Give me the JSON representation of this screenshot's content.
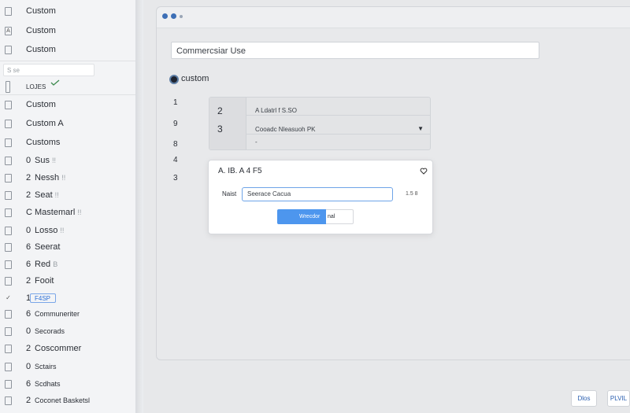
{
  "sidebar": {
    "items": [
      {
        "label": "Custom"
      },
      {
        "label": "Custom"
      },
      {
        "label": "Custom"
      },
      {
        "search_placeholder": "S  se"
      },
      {
        "label": "LOJES"
      },
      {
        "label": "Custom"
      },
      {
        "label": "Custom A"
      },
      {
        "label": "Customs"
      },
      {
        "num": "0",
        "label": "Sus",
        "suffix": "!!"
      },
      {
        "num": "2",
        "label": "Nessh",
        "suffix": "!!"
      },
      {
        "num": "2",
        "label": "Seat",
        "suffix": "!!"
      },
      {
        "num": "C",
        "label": "Mastemarl",
        "suffix": "!!"
      },
      {
        "num": "0",
        "label": "Losso",
        "suffix": "!!"
      },
      {
        "num": "6",
        "label": "Seerat"
      },
      {
        "num": "6",
        "label": "Red",
        "suffix": "B"
      },
      {
        "num": "2",
        "label": "Fooit"
      },
      {
        "num": "1",
        "label": "F4SP"
      },
      {
        "num": "6",
        "label": "Communeriter"
      },
      {
        "num": "0",
        "label": "Secorads"
      },
      {
        "num": "2",
        "label": "Coscommer"
      },
      {
        "num": "0",
        "label": "Sctairs"
      },
      {
        "num": "6",
        "label": "Scdhats"
      },
      {
        "num": "2",
        "label": "Coconet Basketsl"
      }
    ]
  },
  "main": {
    "search_value": "Commercsiar Use",
    "radio_label": "custom",
    "side_numbers": [
      "1",
      "9",
      "8",
      "4",
      "3"
    ],
    "panel": {
      "row_numbers": [
        "2",
        "3"
      ],
      "row1_text": "A Ldatrl  f  S.SO",
      "row2_text": "Cooadc Nleasuoh  PK",
      "row3_text": "-"
    },
    "dialog": {
      "title": "A. IB. A 4 F5",
      "field_label": "Naist",
      "field_value": "Seerace Cacua",
      "meta": "1.5  8",
      "primary_button": "Wrecdor",
      "secondary_button": "nal"
    }
  },
  "footer": {
    "button1": "Dlos",
    "button2": "PLVIL"
  },
  "colors": {
    "accent": "#4d96ee",
    "sidebar_bg": "#f3f4f6",
    "window_bg": "#e8e9eb"
  }
}
